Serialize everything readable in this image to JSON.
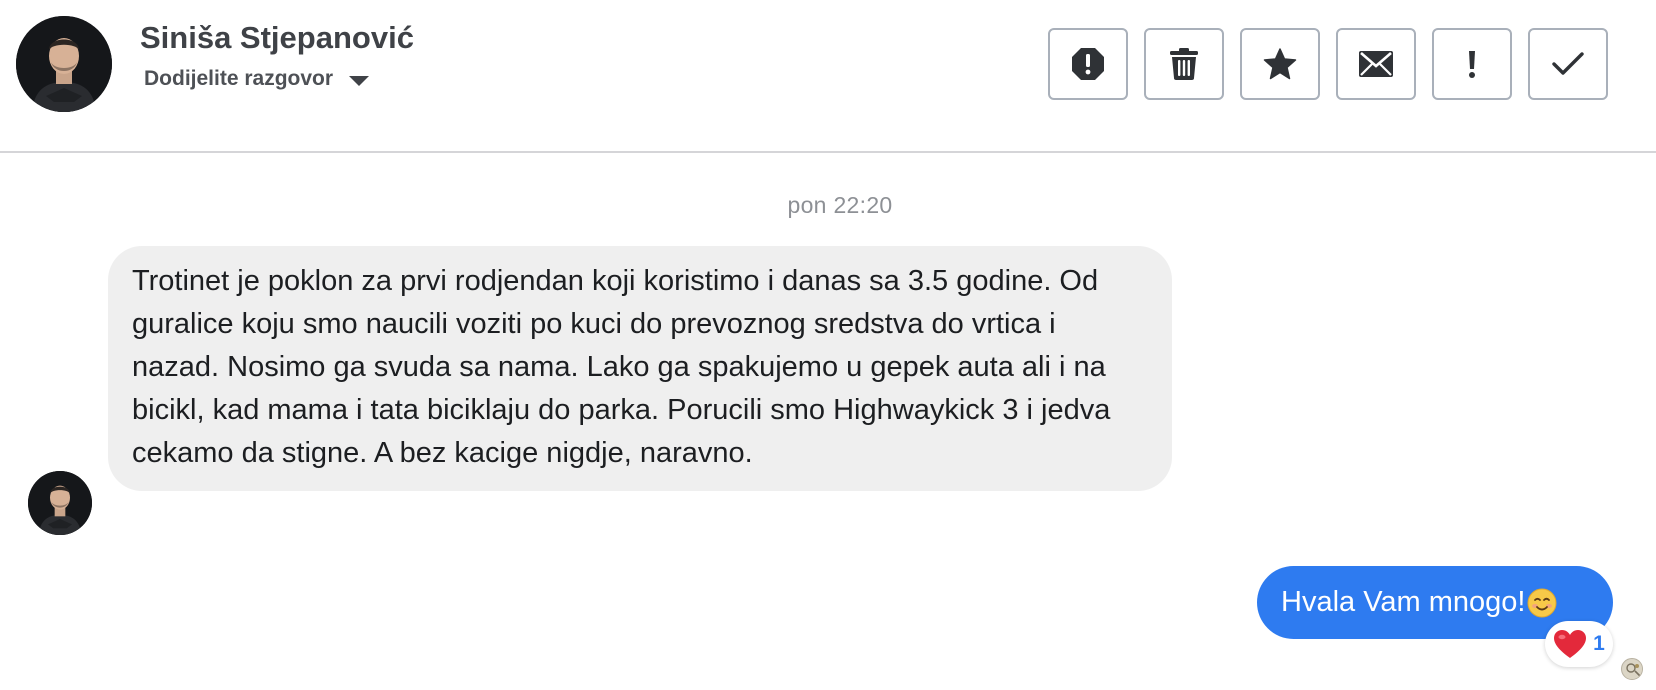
{
  "header": {
    "contact_name": "Siniša Stjepanović",
    "assign_label": "Dodijelite razgovor",
    "toolbar": [
      {
        "name": "report-spam-button",
        "icon": "octagon-exclamation-icon"
      },
      {
        "name": "delete-button",
        "icon": "trash-icon"
      },
      {
        "name": "star-button",
        "icon": "star-icon"
      },
      {
        "name": "mark-unread-button",
        "icon": "envelope-icon"
      },
      {
        "name": "follow-up-button",
        "icon": "exclamation-icon"
      },
      {
        "name": "mark-done-button",
        "icon": "checkmark-icon"
      }
    ]
  },
  "conversation": {
    "timestamp": "pon 22:20",
    "incoming_message": "Trotinet je poklon za prvi rodjendan koji koristimo i danas sa 3.5 godine. Od guralice koju smo naucili voziti po kuci do prevoznog sredstva do vrtica i nazad. Nosimo ga svuda sa nama. Lako ga spakujemo u gepek auta ali i na bicikl, kad mama i tata biciklaju do parka. Porucili smo Highwaykick 3 i jedva cekamo da stigne. A bez kacige nigdje, naravno.",
    "outgoing_message": "Hvala Vam mnogo!",
    "outgoing_emoji": "smiling-face-icon",
    "reaction": {
      "icon": "heart-icon",
      "count": "1"
    }
  },
  "colors": {
    "outgoing_bubble": "#2e7bf0",
    "incoming_bubble": "#efefef",
    "toolbar_border": "#a9b0ba",
    "reaction_count": "#2e7bf0"
  }
}
